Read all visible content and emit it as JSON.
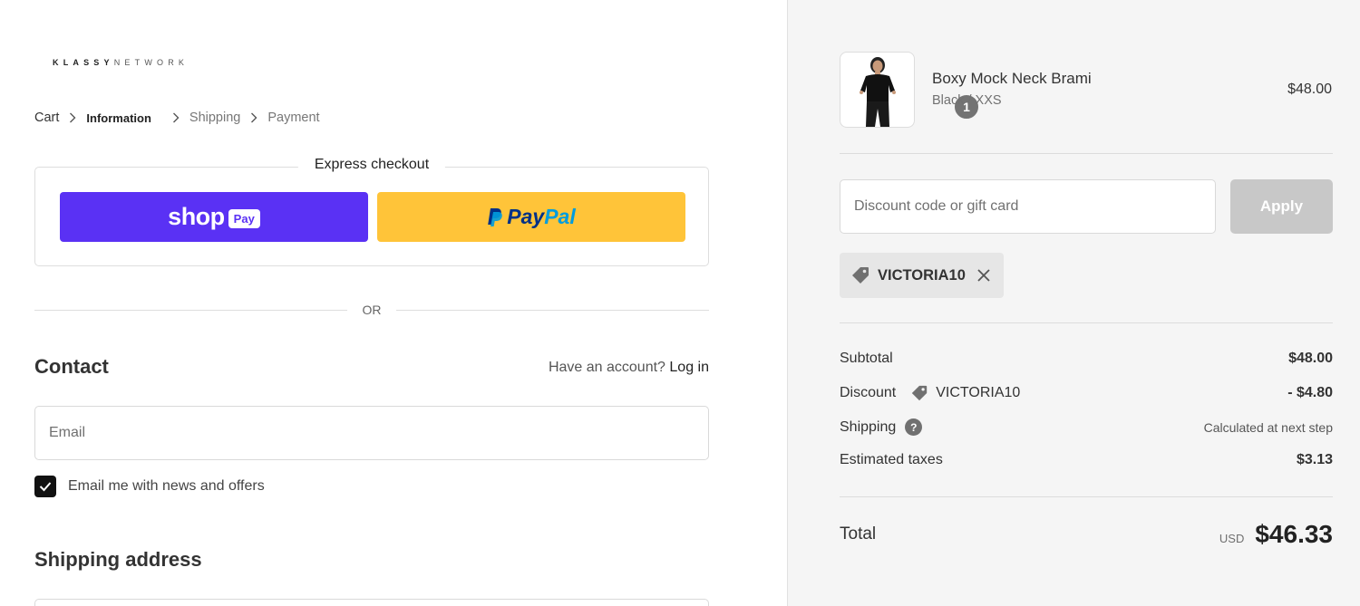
{
  "brand": {
    "logo_bold": "KLASSY",
    "logo_light": "NETWORK"
  },
  "breadcrumb": {
    "items": [
      "Cart",
      "Information",
      "Shipping",
      "Payment"
    ]
  },
  "express": {
    "title": "Express checkout",
    "shop_word": "shop",
    "shop_pay": "Pay",
    "paypal_pay": "Pay",
    "paypal_pal": "Pal",
    "or": "OR"
  },
  "contact": {
    "title": "Contact",
    "have_account": "Have an account?",
    "login": "Log in",
    "email_placeholder": "Email",
    "newsletter_label": "Email me with news and offers",
    "newsletter_checked": true
  },
  "shipping": {
    "title": "Shipping address"
  },
  "order": {
    "product_name": "Boxy Mock Neck Brami",
    "variant": "Black / XXS",
    "price": "$48.00",
    "quantity": "1",
    "discount_placeholder": "Discount code or gift card",
    "apply_label": "Apply",
    "applied_code": "VICTORIA10",
    "subtotal_label": "Subtotal",
    "subtotal": "$48.00",
    "discount_label": "Discount",
    "discount_code": "VICTORIA10",
    "discount": "- $4.80",
    "shipping_label": "Shipping",
    "shipping_help": "?",
    "shipping_value": "Calculated at next step",
    "taxes_label": "Estimated taxes",
    "taxes": "$3.13",
    "total_label": "Total",
    "currency": "USD",
    "total": "$46.33"
  },
  "colors": {
    "shop_pay": "#5a31f4",
    "paypal": "#ffc439",
    "sidebar_bg": "#f5f5f5"
  }
}
